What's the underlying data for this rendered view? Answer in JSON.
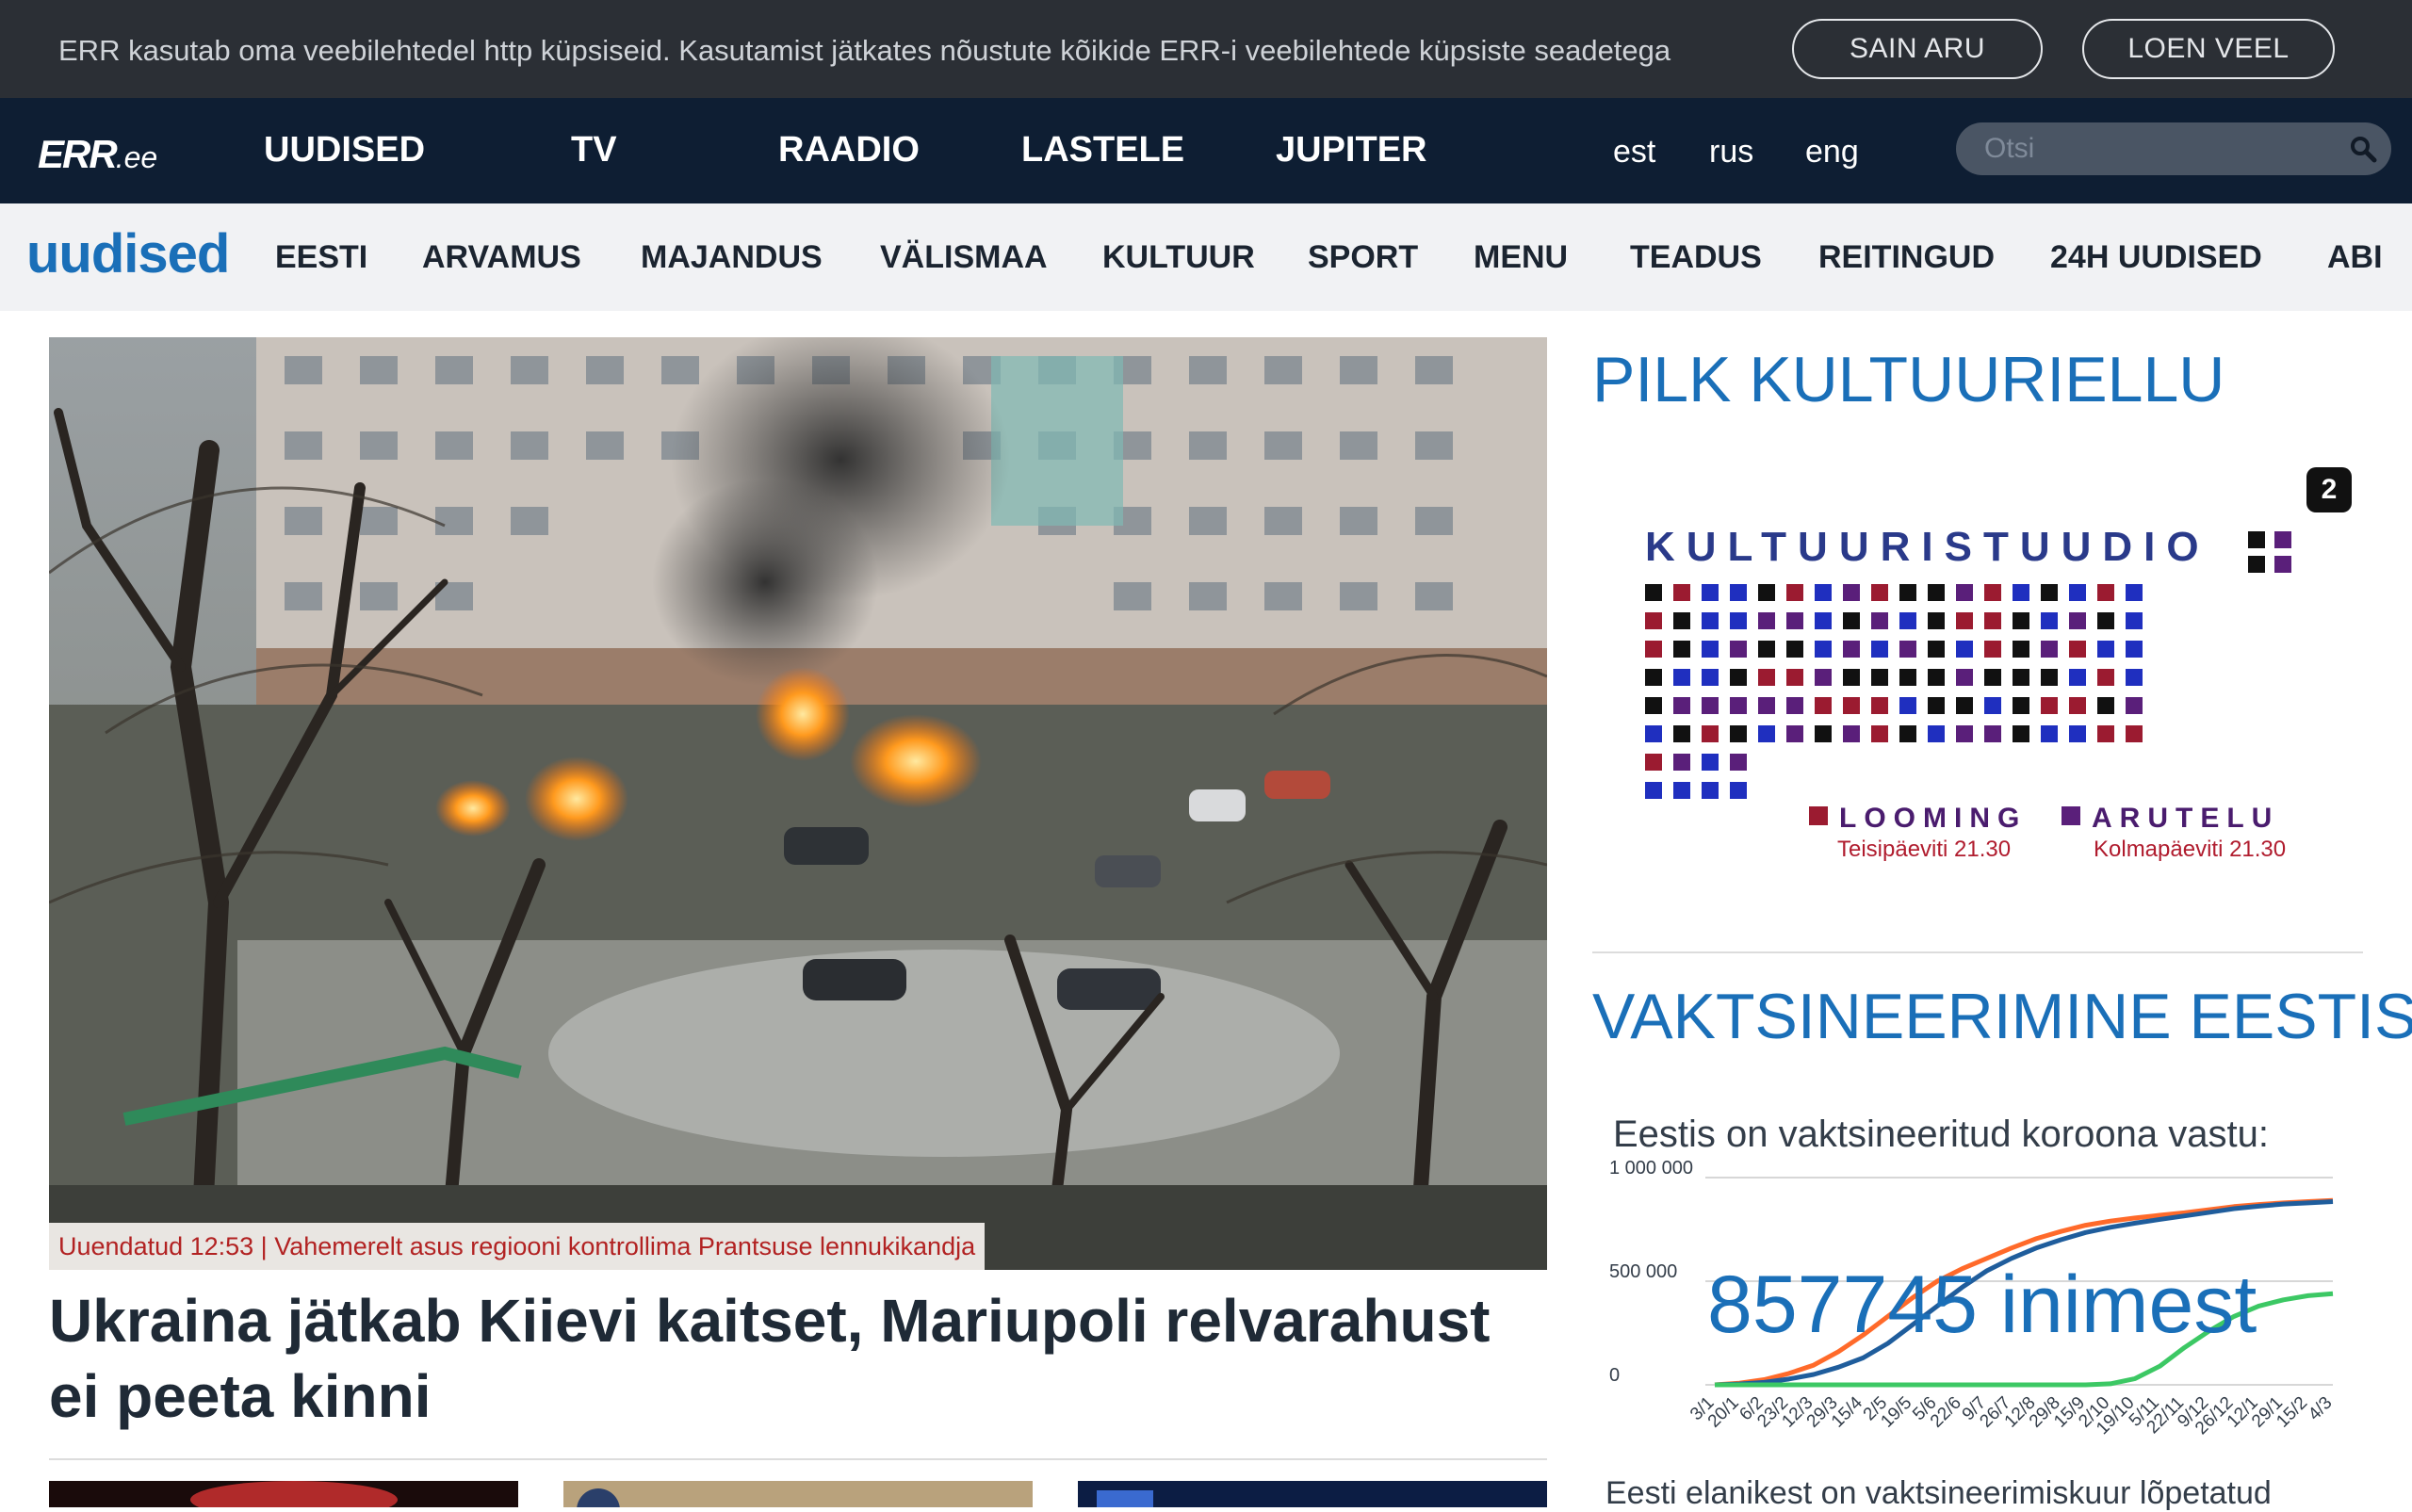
{
  "cookie_bar": {
    "text": "ERR kasutab oma veebilehtedel http küpsiseid. Kasutamist jätkates nõustute kõikide ERR-i veebilehtede küpsiste seadetega",
    "accept_label": "SAIN ARU",
    "more_label": "LOEN VEEL"
  },
  "top_nav": {
    "logo_main": "ERR",
    "logo_suffix": ".ee",
    "items": [
      "UUDISED",
      "TV",
      "RAADIO",
      "LASTELE",
      "JUPITER"
    ],
    "languages": [
      "est",
      "rus",
      "eng"
    ],
    "search_placeholder": "Otsi"
  },
  "section_nav": {
    "title": "uudised",
    "items": [
      "EESTI",
      "ARVAMUS",
      "MAJANDUS",
      "VÄLISMAA",
      "KULTUUR",
      "SPORT",
      "MENU",
      "TEADUS",
      "REITINGUD",
      "24H UUDISED",
      "ABI"
    ]
  },
  "hero": {
    "caption": "Uuendatud 12:53 | Vahemerelt asus regiooni kontrollima Prantsuse lennukikandja",
    "headline": "Ukraina jätkab Kiievi kaitset, Mariupoli relvarahust ei peeta kinni"
  },
  "sidebar": {
    "culture_title": "PILK KULTUURIELLU",
    "promo": {
      "channel_badge": "2",
      "heading": "KULTUURISTUUDIO",
      "label_left": "LOOMING",
      "label_right": "ARUTELU",
      "time_left": "Teisipäeviti 21.30",
      "time_right": "Kolmapäeviti 21.30",
      "colors": [
        "#1f2fbf",
        "#111111",
        "#9b1b30",
        "#5a1f7a"
      ]
    },
    "vax_title": "VAKTSINEERIMINE EESTIS",
    "vax_subtitle": "Eestis on vaktsineeritud koroona vastu:",
    "vax_count": "857745 inimest",
    "vax_footer": "Eesti elanikest on vaktsineerimiskuur lõpetatud"
  },
  "chart_data": {
    "type": "line",
    "x": [
      "3/1",
      "20/1",
      "6/2",
      "23/2",
      "12/3",
      "29/3",
      "15/4",
      "2/5",
      "19/5",
      "5/6",
      "22/6",
      "9/7",
      "26/7",
      "12/8",
      "29/8",
      "15/9",
      "2/10",
      "19/10",
      "5/11",
      "22/11",
      "9/12",
      "26/12",
      "12/1",
      "29/1",
      "15/2",
      "4/3"
    ],
    "y_ticks": [
      "1 000 000",
      "500 000",
      "0"
    ],
    "ylim": [
      0,
      1000000
    ],
    "grid": true,
    "series": [
      {
        "color": "#ff6a2a",
        "values": [
          0,
          8000,
          25000,
          55000,
          95000,
          160000,
          240000,
          330000,
          420000,
          500000,
          560000,
          610000,
          660000,
          705000,
          740000,
          770000,
          790000,
          805000,
          818000,
          830000,
          845000,
          860000,
          870000,
          878000,
          884000,
          890000
        ]
      },
      {
        "color": "#1f5d9c",
        "values": [
          0,
          4000,
          12000,
          28000,
          50000,
          85000,
          130000,
          200000,
          290000,
          380000,
          470000,
          550000,
          610000,
          660000,
          700000,
          735000,
          760000,
          780000,
          798000,
          815000,
          832000,
          850000,
          862000,
          872000,
          878000,
          884000
        ]
      },
      {
        "color": "#3cc864",
        "values": [
          0,
          0,
          0,
          0,
          0,
          0,
          0,
          0,
          0,
          0,
          0,
          0,
          0,
          0,
          0,
          0,
          5000,
          30000,
          90000,
          180000,
          260000,
          330000,
          380000,
          410000,
          430000,
          440000
        ]
      }
    ]
  }
}
